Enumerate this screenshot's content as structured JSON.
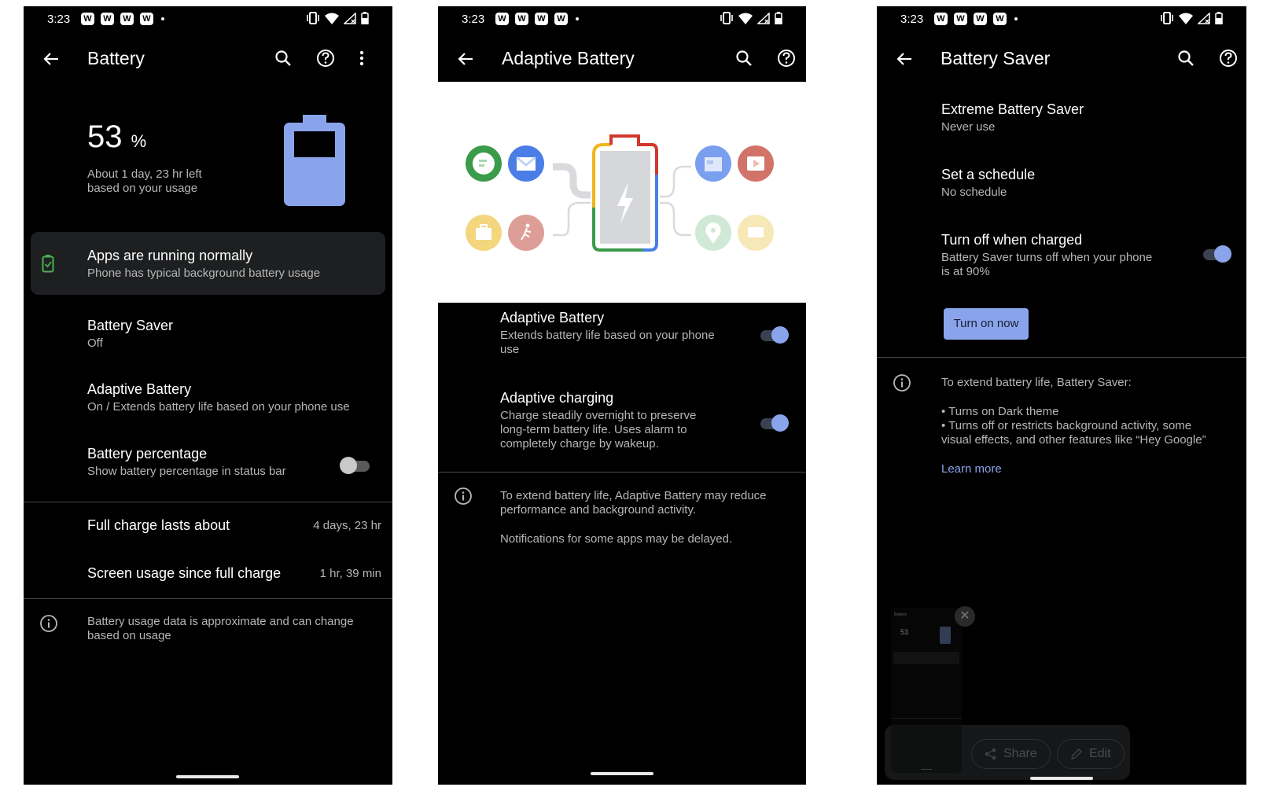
{
  "status_bar": {
    "time": "3:23",
    "notification_badges": [
      "W",
      "W",
      "W",
      "W"
    ],
    "icons": [
      "vibrate-icon",
      "wifi-icon",
      "no-signal-icon",
      "battery-icon"
    ]
  },
  "screens": {
    "battery": {
      "title": "Battery",
      "actions": [
        "search",
        "help",
        "more"
      ],
      "percent_value": "53",
      "percent_sign": "%",
      "level_percent": 53,
      "time_left_line1": "About 1 day, 23 hr left",
      "time_left_line2": "based on your usage",
      "status_card": {
        "title": "Apps are running normally",
        "subtitle": "Phone has typical background battery usage"
      },
      "items": [
        {
          "title": "Battery Saver",
          "subtitle": "Off"
        },
        {
          "title": "Adaptive Battery",
          "subtitle": "On / Extends battery life based on your phone use"
        },
        {
          "title": "Battery percentage",
          "subtitle": "Show battery percentage in status bar",
          "toggle": "off"
        }
      ],
      "stats": [
        {
          "label": "Full charge lasts about",
          "value": "4 days, 23 hr"
        },
        {
          "label": "Screen usage since full charge",
          "value": "1 hr, 39 min"
        }
      ],
      "footer_line1": "Battery usage data is approximate and can change",
      "footer_line2": "based on usage"
    },
    "adaptive": {
      "title": "Adaptive Battery",
      "actions": [
        "search",
        "help"
      ],
      "items": [
        {
          "title": "Adaptive Battery",
          "subtitle_lines": [
            "Extends battery life based on your phone",
            "use"
          ],
          "toggle": "on"
        },
        {
          "title": "Adaptive charging",
          "subtitle_lines": [
            "Charge steadily overnight to preserve",
            "long-term battery life. Uses alarm to",
            "completely charge by wakeup."
          ],
          "toggle": "on"
        }
      ],
      "info_line1": "To extend battery life, Adaptive Battery may reduce",
      "info_line2": "performance and background activity.",
      "info_line3": "Notifications for some apps may be delayed."
    },
    "saver": {
      "title": "Battery Saver",
      "actions": [
        "search",
        "help"
      ],
      "items": [
        {
          "title": "Extreme Battery Saver",
          "subtitle": "Never use"
        },
        {
          "title": "Set a schedule",
          "subtitle": "No schedule"
        },
        {
          "title": "Turn off when charged",
          "subtitle_lines": [
            "Battery Saver turns off when your phone",
            "is at 90%"
          ],
          "toggle": "on"
        }
      ],
      "button_label": "Turn on now",
      "info_heading": "To extend battery life, Battery Saver:",
      "info_bullet1": "• Turns on Dark theme",
      "info_bullet2a": "• Turns off or restricts background activity, some",
      "info_bullet2b": "visual effects, and other features like “Hey Google”",
      "learn_more": "Learn more",
      "screenshot_tray": {
        "share_label": "Share",
        "edit_label": "Edit",
        "close_label": "✕"
      }
    }
  },
  "colors": {
    "accent": "#8aa4ec",
    "background": "#000000",
    "card": "#1e1f21",
    "secondary_text": "#b6b6b6",
    "status_ok": "#4caf50"
  }
}
